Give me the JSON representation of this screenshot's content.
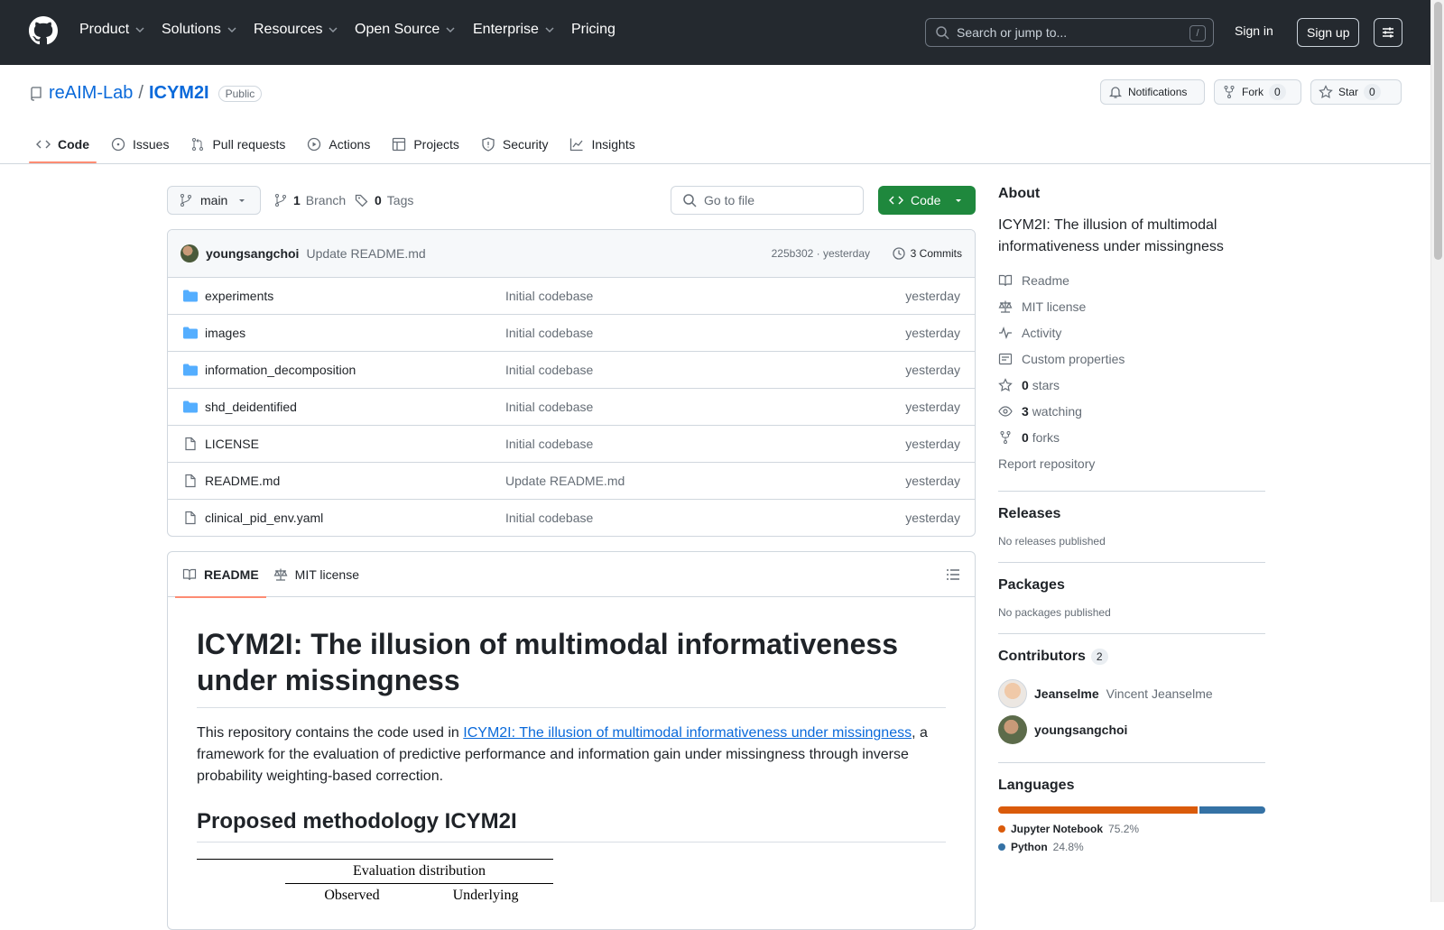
{
  "header": {
    "nav": [
      {
        "label": "Product",
        "has_menu": true
      },
      {
        "label": "Solutions",
        "has_menu": true
      },
      {
        "label": "Resources",
        "has_menu": true
      },
      {
        "label": "Open Source",
        "has_menu": true
      },
      {
        "label": "Enterprise",
        "has_menu": true
      },
      {
        "label": "Pricing",
        "has_menu": false
      }
    ],
    "search_placeholder": "Search or jump to...",
    "search_shortcut": "/",
    "sign_in": "Sign in",
    "sign_up": "Sign up"
  },
  "repo": {
    "owner": "reAIM-Lab",
    "separator": "/",
    "name": "ICYM2I",
    "visibility": "Public",
    "notifications_label": "Notifications",
    "fork_label": "Fork",
    "fork_count": "0",
    "star_label": "Star",
    "star_count": "0"
  },
  "tabs": [
    {
      "label": "Code",
      "icon": "code-icon",
      "active": true
    },
    {
      "label": "Issues",
      "icon": "issue-icon",
      "active": false
    },
    {
      "label": "Pull requests",
      "icon": "pull-request-icon",
      "active": false
    },
    {
      "label": "Actions",
      "icon": "play-icon",
      "active": false
    },
    {
      "label": "Projects",
      "icon": "table-icon",
      "active": false
    },
    {
      "label": "Security",
      "icon": "shield-icon",
      "active": false
    },
    {
      "label": "Insights",
      "icon": "graph-icon",
      "active": false
    }
  ],
  "toolbar": {
    "branch": "main",
    "branch_count": "1",
    "branch_label": "Branch",
    "tag_count": "0",
    "tag_label": "Tags",
    "goto_placeholder": "Go to file",
    "code_button": "Code"
  },
  "latest_commit": {
    "author": "youngsangchoi",
    "message": "Update README.md",
    "meta": "225b302 · yesterday",
    "commits_label": "3 Commits"
  },
  "files": [
    {
      "name": "experiments",
      "type": "folder",
      "message": "Initial codebase",
      "date": "yesterday"
    },
    {
      "name": "images",
      "type": "folder",
      "message": "Initial codebase",
      "date": "yesterday"
    },
    {
      "name": "information_decomposition",
      "type": "folder",
      "message": "Initial codebase",
      "date": "yesterday"
    },
    {
      "name": "shd_deidentified",
      "type": "folder",
      "message": "Initial codebase",
      "date": "yesterday"
    },
    {
      "name": "LICENSE",
      "type": "file",
      "message": "Initial codebase",
      "date": "yesterday"
    },
    {
      "name": "README.md",
      "type": "file",
      "message": "Update README.md",
      "date": "yesterday"
    },
    {
      "name": "clinical_pid_env.yaml",
      "type": "file",
      "message": "Initial codebase",
      "date": "yesterday"
    }
  ],
  "readme": {
    "tab_readme": "README",
    "tab_license": "MIT license",
    "title": "ICYM2I: The illusion of multimodal informativeness under missingness",
    "intro_before": "This repository contains the code used in ",
    "intro_link": "ICYM2I: The illusion of multimodal informativeness under missingness",
    "intro_after": ", a framework for the evaluation of predictive performance and information gain under missingness through inverse probability weighting-based correction.",
    "section_title": "Proposed methodology ICYM2I",
    "table_header": "Evaluation distribution",
    "table_col1": "Observed",
    "table_col2": "Underlying"
  },
  "sidebar": {
    "about_title": "About",
    "about_desc": "ICYM2I: The illusion of multimodal informativeness under missingness",
    "links": [
      {
        "icon": "book-icon",
        "count": "",
        "label": "Readme"
      },
      {
        "icon": "law-icon",
        "count": "",
        "label": "MIT license"
      },
      {
        "icon": "pulse-icon",
        "count": "",
        "label": "Activity"
      },
      {
        "icon": "note-icon",
        "count": "",
        "label": "Custom properties"
      },
      {
        "icon": "star-icon",
        "count": "0",
        "label": "stars"
      },
      {
        "icon": "eye-icon",
        "count": "3",
        "label": "watching"
      },
      {
        "icon": "fork-icon",
        "count": "0",
        "label": "forks"
      }
    ],
    "report": "Report repository",
    "releases_title": "Releases",
    "releases_empty": "No releases published",
    "packages_title": "Packages",
    "packages_empty": "No packages published",
    "contributors_title": "Contributors",
    "contributors_count": "2",
    "contributors": [
      {
        "login": "Jeanselme",
        "name": "Vincent Jeanselme"
      },
      {
        "login": "youngsangchoi",
        "name": ""
      }
    ],
    "languages_title": "Languages",
    "languages": [
      {
        "name": "Jupyter Notebook",
        "percent": "75.2%",
        "value": 75.2,
        "color": "#DA5B0B"
      },
      {
        "name": "Python",
        "percent": "24.8%",
        "value": 24.8,
        "color": "#3572A5"
      }
    ]
  },
  "colors": {
    "header_bg": "#24292f",
    "link": "#0969da",
    "code_button": "#1f883d",
    "tab_underline": "#fd8c73"
  }
}
